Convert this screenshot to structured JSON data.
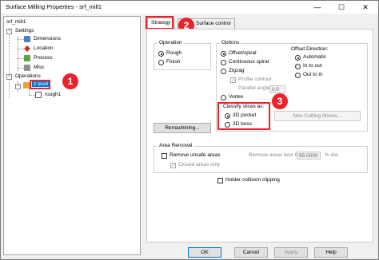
{
  "window": {
    "title": "Surface Milling Properties - srf_mill1",
    "minimize": "—",
    "maximize": "☐",
    "close": "✕"
  },
  "tree": {
    "root": "srf_mill1",
    "settings": "Settings",
    "dimensions": "Dimensions",
    "location": "Location",
    "process": "Process",
    "misc": "Misc",
    "operations": "Operations",
    "zlevel": "z level",
    "rough1": "rough1"
  },
  "tabs": {
    "strategy": "Strategy",
    "surface_control": "Surface control"
  },
  "operation": {
    "label": "Operation",
    "rough": "Rough",
    "finish": "Finish"
  },
  "options": {
    "label": "Options",
    "offset_spiral": "Offset/spiral",
    "continuous_spiral": "Continuous spiral",
    "zigzag": "Zigzag",
    "profile_contour": "Profile contour",
    "parallel_angle": "Parallel angle",
    "parallel_angle_value": "0.0",
    "vortex": "Vortex",
    "offset_direction": "Offset Direction:",
    "automatic": "Automatic",
    "in_to_out": "In to out",
    "out_to_in": "Out to in",
    "classify": "Classify slices as:",
    "pocket3d": "3D pocket",
    "boss3d": "3D boss",
    "non_cutting": "Non-Cutting Moves..."
  },
  "remachining": "Remachining...",
  "area_removal": {
    "label": "Area Removal",
    "remove_unsafe": "Remove unsafe areas",
    "area_less_than": "Remove areas less than:",
    "area_value": "95.0000",
    "unit": "% dia.",
    "closed_only": "Closed areas only"
  },
  "holder_collision": "Holder collision clipping",
  "buttons": {
    "ok": "OK",
    "cancel": "Cancel",
    "apply": "Apply",
    "help": "Help"
  },
  "callouts": {
    "one": "1",
    "two": "2",
    "three": "3"
  },
  "colors": {
    "callout": "#e8232b",
    "selection": "#0078d7"
  }
}
